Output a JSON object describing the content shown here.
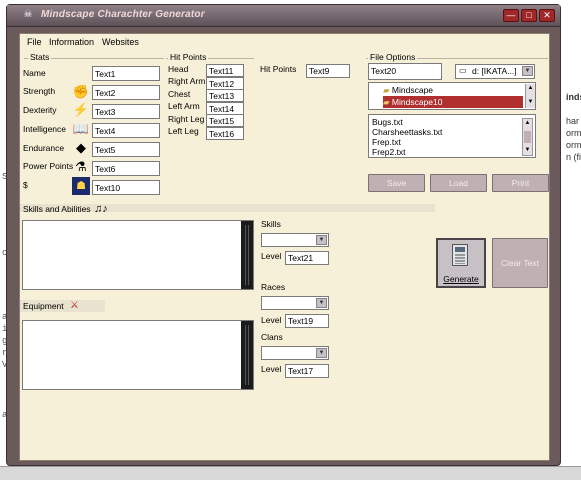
{
  "window": {
    "title": "Mindscape Charachter Generator",
    "min_glyph": "—",
    "max_glyph": "□",
    "close_glyph": "✕"
  },
  "background": {
    "left_lines": [
      "SI",
      "ca",
      "an",
      "ia",
      "ge",
      "ri",
      "Va",
      "an"
    ],
    "right_lines": [
      "inds",
      "har",
      "orm",
      "orm",
      "n (fi"
    ]
  },
  "menu": [
    "File",
    "Information",
    "Websites"
  ],
  "stats": {
    "group_label": "Stats",
    "rows": [
      {
        "label": "Name",
        "value": "Text1",
        "icon": ""
      },
      {
        "label": "Strength",
        "value": "Text2",
        "icon": "fist-icon"
      },
      {
        "label": "Dexterity",
        "value": "Text3",
        "icon": "lightning-icon"
      },
      {
        "label": "Intelligence",
        "value": "Text4",
        "icon": "book-icon"
      },
      {
        "label": "Endurance",
        "value": "Text5",
        "icon": "shield-icon"
      },
      {
        "label": "Power Points",
        "value": "Text6",
        "icon": "potion-icon"
      },
      {
        "label": "$",
        "value": "Text10",
        "icon": "coins-icon"
      }
    ]
  },
  "hit_points": {
    "group_label": "Hit Points",
    "rows": [
      {
        "label": "Head",
        "value": "Text11"
      },
      {
        "label": "Right Arm",
        "value": "Text12"
      },
      {
        "label": "Chest",
        "value": "Text13"
      },
      {
        "label": "Left Arm",
        "value": "Text14"
      },
      {
        "label": "Right Leg",
        "value": "Text15"
      },
      {
        "label": "Left Leg",
        "value": "Text16"
      }
    ],
    "total_label": "Hit Points",
    "total_value": "Text9"
  },
  "file_options": {
    "group_label": "File Options",
    "filename": "Text20",
    "drive": "d: [IKATA...]",
    "folders": [
      "Mindscape",
      "Mindscape10"
    ],
    "files": [
      "Bugs.txt",
      "Charsheettasks.txt",
      "Frep.txt",
      "Frep2.txt"
    ],
    "save_label": "Save",
    "load_label": "Load",
    "print_label": "Print"
  },
  "skills_section": {
    "label": "Skills and Abilities"
  },
  "equipment_section": {
    "label": "Equipment"
  },
  "skills": {
    "label": "Skills",
    "selected": "",
    "level_label": "Level",
    "level_value": "Text21"
  },
  "races": {
    "label": "Races",
    "selected": "",
    "level_label": "Level",
    "level_value": "Text19"
  },
  "clans": {
    "label": "Clans",
    "selected": "",
    "level_label": "Level",
    "level_value": "Text17"
  },
  "actions": {
    "generate_label": "Generate",
    "clear_label": "Clear Text"
  },
  "colors": {
    "window_frame": "#6a5a5c",
    "client_bg": "#f6f0d8",
    "selected": "#b03030",
    "button": "#bfb0b4"
  }
}
